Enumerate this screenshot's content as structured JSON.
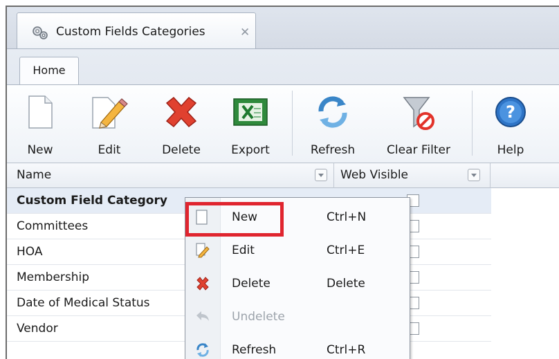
{
  "window": {
    "doc_tab_title": "Custom Fields Categories",
    "doc_tab_close": "✕"
  },
  "ribbon": {
    "tab_label": "Home",
    "buttons": [
      {
        "label": "New",
        "icon": "new-document-icon"
      },
      {
        "label": "Edit",
        "icon": "edit-pencil-icon"
      },
      {
        "label": "Delete",
        "icon": "delete-x-icon"
      },
      {
        "label": "Export",
        "icon": "excel-export-icon"
      },
      {
        "label": "Refresh",
        "icon": "refresh-icon"
      },
      {
        "label": "Clear Filter",
        "icon": "clear-filter-icon"
      },
      {
        "label": "Help",
        "icon": "help-icon"
      }
    ]
  },
  "grid": {
    "columns": [
      "Name",
      "Web Visible"
    ],
    "rows": [
      {
        "name": "Custom Field Category",
        "selected": true
      },
      {
        "name": "Committees"
      },
      {
        "name": "HOA"
      },
      {
        "name": "Membership"
      },
      {
        "name": "Date of Medical Status"
      },
      {
        "name": "Vendor"
      }
    ]
  },
  "context_menu": {
    "items": [
      {
        "label": "New",
        "shortcut": "Ctrl+N",
        "icon": "blank-page-icon"
      },
      {
        "label": "Edit",
        "shortcut": "Ctrl+E",
        "icon": "pencil-icon"
      },
      {
        "label": "Delete",
        "shortcut": "Delete",
        "icon": "red-x-icon"
      },
      {
        "label": "Undelete",
        "shortcut": "",
        "icon": "undo-arrow-icon",
        "disabled": true
      },
      {
        "label": "Refresh",
        "shortcut": "Ctrl+R",
        "icon": "refresh-icon"
      }
    ]
  },
  "colors": {
    "highlight": "#e0252f",
    "selected_row": "#e5ecf6"
  }
}
